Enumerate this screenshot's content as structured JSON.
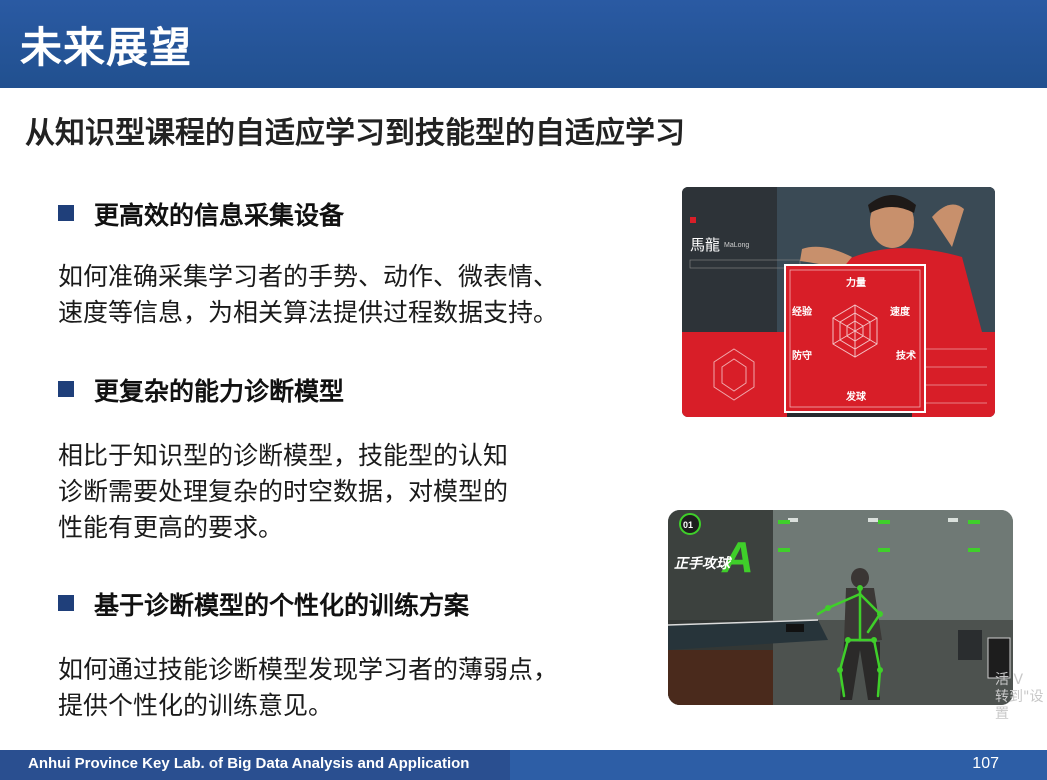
{
  "header": {
    "title": "未来展望"
  },
  "subtitle": "从知识型课程的自适应学习到技能型的自适应学习",
  "sections": [
    {
      "heading": "更高效的信息采集设备",
      "lines": [
        "如何准确采集学习者的手势、动作、微表情、",
        "速度等信息，为相关算法提供过程数据支持。"
      ]
    },
    {
      "heading": "更复杂的能力诊断模型",
      "lines": [
        "相比于知识型的诊断模型，技能型的认知",
        "诊断需要处理复杂的时空数据，对模型的",
        "性能有更高的要求。"
      ]
    },
    {
      "heading": "基于诊断模型的个性化的训练方案",
      "lines": [
        "如何通过技能诊断模型发现学习者的薄弱点，",
        "提供个性化的训练意见。"
      ]
    }
  ],
  "image1": {
    "player_name": "馬龍",
    "player_name_latin": "MaLong",
    "radar_labels": {
      "top": "力量",
      "right_top": "速度",
      "right_bottom": "技术",
      "bottom": "发球",
      "left_bottom": "防守",
      "left_top": "经验"
    }
  },
  "image2": {
    "badge": "01",
    "caption": "正手攻球",
    "letter": "A"
  },
  "watermark": {
    "line1": "活 V",
    "line2": "转到\"设置"
  },
  "footer": {
    "text": "Anhui Province Key Lab. of Big Data Analysis and Application",
    "page": "107"
  },
  "colors": {
    "header": "#2a5aa3",
    "bullet": "#1f3f7a",
    "image1_red": "#d81e28",
    "image2_green": "#3fcf2a"
  }
}
